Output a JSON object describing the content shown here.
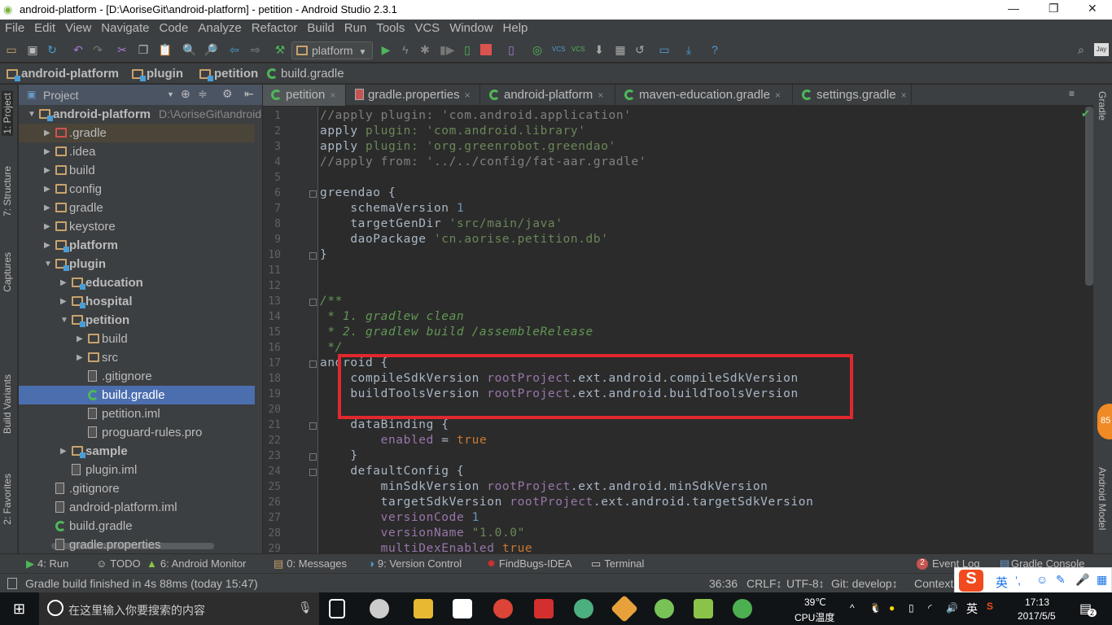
{
  "window": {
    "title": "android-platform - [D:\\AoriseGit\\android-platform] - petition - Android Studio 2.3.1",
    "minimize": "—",
    "maximize": "❐",
    "close": "✕"
  },
  "menu": [
    "File",
    "Edit",
    "View",
    "Navigate",
    "Code",
    "Analyze",
    "Refactor",
    "Build",
    "Run",
    "Tools",
    "VCS",
    "Window",
    "Help"
  ],
  "toolbar": {
    "run_config": "platform",
    "jay": "Jay"
  },
  "breadcrumb": [
    "android-platform",
    "plugin",
    "petition",
    "build.gradle"
  ],
  "left_stripe": {
    "project": "1: Project",
    "structure": "7: Structure",
    "captures": "Captures",
    "build_variants": "Build Variants",
    "favorites": "2: Favorites"
  },
  "right_stripe": {
    "gradle": "Gradle",
    "android_model": "Android Model",
    "badge": "85"
  },
  "project_panel": {
    "title": "Project",
    "tree": [
      {
        "label": "android-platform",
        "extra": "D:\\AoriseGit\\android-platform",
        "level": 0,
        "arrow": "down",
        "icon": "module",
        "bold": true
      },
      {
        "label": ".gradle",
        "level": 1,
        "arrow": "right",
        "icon": "folder-red",
        "hl": true
      },
      {
        "label": ".idea",
        "level": 1,
        "arrow": "right",
        "icon": "folder"
      },
      {
        "label": "build",
        "level": 1,
        "arrow": "right",
        "icon": "folder"
      },
      {
        "label": "config",
        "level": 1,
        "arrow": "right",
        "icon": "folder"
      },
      {
        "label": "gradle",
        "level": 1,
        "arrow": "right",
        "icon": "folder"
      },
      {
        "label": "keystore",
        "level": 1,
        "arrow": "right",
        "icon": "folder"
      },
      {
        "label": "platform",
        "level": 1,
        "arrow": "right",
        "icon": "module",
        "bold": true
      },
      {
        "label": "plugin",
        "level": 1,
        "arrow": "down",
        "icon": "module",
        "bold": true
      },
      {
        "label": "education",
        "level": 2,
        "arrow": "right",
        "icon": "module",
        "bold": true
      },
      {
        "label": "hospital",
        "level": 2,
        "arrow": "right",
        "icon": "module",
        "bold": true
      },
      {
        "label": "petition",
        "level": 2,
        "arrow": "down",
        "icon": "module",
        "bold": true
      },
      {
        "label": "build",
        "level": 3,
        "arrow": "right",
        "icon": "folder"
      },
      {
        "label": "src",
        "level": 3,
        "arrow": "right",
        "icon": "folder"
      },
      {
        "label": ".gitignore",
        "level": 3,
        "icon": "file"
      },
      {
        "label": "build.gradle",
        "level": 3,
        "icon": "gradle",
        "selected": true
      },
      {
        "label": "petition.iml",
        "level": 3,
        "icon": "file"
      },
      {
        "label": "proguard-rules.pro",
        "level": 3,
        "icon": "file"
      },
      {
        "label": "sample",
        "level": 2,
        "arrow": "right",
        "icon": "module",
        "bold": true
      },
      {
        "label": "plugin.iml",
        "level": 2,
        "icon": "file"
      },
      {
        "label": ".gitignore",
        "level": 1,
        "icon": "file"
      },
      {
        "label": "android-platform.iml",
        "level": 1,
        "icon": "file"
      },
      {
        "label": "build.gradle",
        "level": 1,
        "icon": "gradle"
      },
      {
        "label": "gradle.properties",
        "level": 1,
        "icon": "file"
      }
    ]
  },
  "tabs": [
    {
      "label": "petition",
      "active": true
    },
    {
      "label": "gradle.properties"
    },
    {
      "label": "android-platform"
    },
    {
      "label": "maven-education.gradle"
    },
    {
      "label": "settings.gradle"
    }
  ],
  "tab_close": "×",
  "editor": {
    "lines": [
      [
        [
          "//apply plugin: 'com.android.application'",
          "com"
        ]
      ],
      [
        [
          "apply ",
          ""
        ],
        [
          "plugin: ",
          "plug"
        ],
        [
          "'com.android.library'",
          "str"
        ]
      ],
      [
        [
          "apply ",
          ""
        ],
        [
          "plugin: ",
          "plug"
        ],
        [
          "'org.greenrobot.greendao'",
          "str"
        ]
      ],
      [
        [
          "//apply from: '../../config/fat-aar.gradle'",
          "com"
        ]
      ],
      [],
      [
        [
          "greendao {",
          ""
        ]
      ],
      [
        [
          "    schemaVersion ",
          ""
        ],
        [
          "1",
          "num"
        ]
      ],
      [
        [
          "    targetGenDir ",
          ""
        ],
        [
          "'src/main/java'",
          "str"
        ]
      ],
      [
        [
          "    daoPackage ",
          ""
        ],
        [
          "'cn.aorise.petition.db'",
          "str"
        ]
      ],
      [
        [
          "}",
          ""
        ]
      ],
      [],
      [],
      [
        [
          "/**",
          "doc"
        ]
      ],
      [
        [
          " * 1. gradlew clean",
          "doc"
        ]
      ],
      [
        [
          " * 2. gradlew build /assembleRelease",
          "doc"
        ]
      ],
      [
        [
          " */",
          "doc"
        ]
      ],
      [
        [
          "android {",
          ""
        ]
      ],
      [
        [
          "    compileSdkVersion ",
          ""
        ],
        [
          "rootProject",
          "prop"
        ],
        [
          ".ext.android.compileSdkVersion",
          ""
        ]
      ],
      [
        [
          "    buildToolsVersion ",
          ""
        ],
        [
          "rootProject",
          "prop"
        ],
        [
          ".ext.android.buildToolsVersion",
          ""
        ]
      ],
      [],
      [
        [
          "    dataBinding {",
          ""
        ]
      ],
      [
        [
          "        ",
          ""
        ],
        [
          "enabled",
          "prop"
        ],
        [
          " = ",
          ""
        ],
        [
          "true",
          "kw"
        ]
      ],
      [
        [
          "    }",
          ""
        ]
      ],
      [
        [
          "    defaultConfig {",
          ""
        ]
      ],
      [
        [
          "        minSdkVersion ",
          ""
        ],
        [
          "rootProject",
          "prop"
        ],
        [
          ".ext.android.minSdkVersion",
          ""
        ]
      ],
      [
        [
          "        targetSdkVersion ",
          ""
        ],
        [
          "rootProject",
          "prop"
        ],
        [
          ".ext.android.targetSdkVersion",
          ""
        ]
      ],
      [
        [
          "        ",
          ""
        ],
        [
          "versionCode",
          "prop"
        ],
        [
          " ",
          ""
        ],
        [
          "1",
          "num"
        ]
      ],
      [
        [
          "        ",
          ""
        ],
        [
          "versionName",
          "prop"
        ],
        [
          " ",
          ""
        ],
        [
          "\"1.0.0\"",
          "str"
        ]
      ],
      [
        [
          "        ",
          ""
        ],
        [
          "multiDexEnabled",
          "prop"
        ],
        [
          " ",
          ""
        ],
        [
          "true",
          "kw"
        ]
      ]
    ],
    "fold_lines": [
      6,
      10,
      13,
      17,
      21,
      23,
      24
    ]
  },
  "bottom_tools": [
    {
      "label": "4: Run"
    },
    {
      "label": "TODO"
    },
    {
      "label": "6: Android Monitor"
    },
    {
      "label": "0: Messages"
    },
    {
      "label": "9: Version Control"
    },
    {
      "label": "FindBugs-IDEA"
    },
    {
      "label": "Terminal"
    }
  ],
  "bottom_right": {
    "event_log": "Event Log",
    "event_count": "2",
    "gradle_console": "Gradle Console"
  },
  "status": {
    "message": "Gradle build finished in 4s 88ms (today 15:47)",
    "position": "36:36",
    "line_sep": "CRLF↕",
    "encoding": "UTF-8↕",
    "git": "Git: develop↕",
    "context": "Context"
  },
  "ime": {
    "lang": "英",
    "punct": "’,"
  },
  "taskbar": {
    "search_placeholder": "在这里输入你要搜索的内容",
    "temp": "39℃",
    "temp_label": "CPU温度",
    "lang": "英",
    "time": "17:13",
    "date": "2017/5/5",
    "notif": "2"
  }
}
